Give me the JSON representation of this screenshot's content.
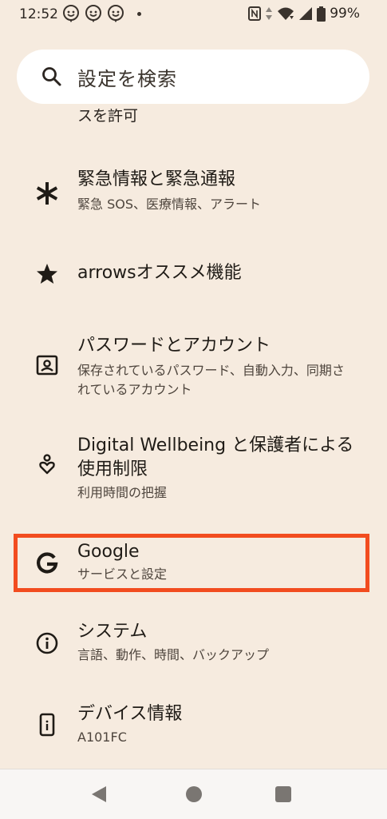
{
  "status_bar": {
    "time": "12:52",
    "battery": "99%",
    "notification_icons": [
      "face-notification-icon",
      "face-notification-icon",
      "face-notification-icon"
    ],
    "system_icons": [
      "nfc-icon",
      "data-arrows-icon",
      "wifi-icon",
      "signal-icon",
      "battery-icon"
    ]
  },
  "search": {
    "placeholder": "設定を検索"
  },
  "clipped_item": {
    "text": "スを許可"
  },
  "items": [
    {
      "title": "緊急情報と緊急通報",
      "subtitle": "緊急 SOS、医療情報、アラート",
      "icon": "asterisk-icon"
    },
    {
      "title": "arrowsオススメ機能",
      "subtitle": "",
      "icon": "star-icon"
    },
    {
      "title": "パスワードとアカウント",
      "subtitle": "保存されているパスワード、自動入力、同期されているアカウント",
      "icon": "account-box-icon"
    },
    {
      "title": "Digital Wellbeing と保護者による使用制限",
      "subtitle": "利用時間の把握",
      "icon": "wellbeing-icon"
    },
    {
      "title": "Google",
      "subtitle": "サービスと設定",
      "icon": "google-icon"
    },
    {
      "title": "システム",
      "subtitle": "言語、動作、時間、バックアップ",
      "icon": "info-icon"
    },
    {
      "title": "デバイス情報",
      "subtitle": "A101FC",
      "icon": "phone-info-icon"
    }
  ],
  "highlight_color": "#f24c1f",
  "background_color": "#f6ebdf",
  "nav_bar": {
    "buttons": [
      "back-icon",
      "home-icon",
      "recents-icon"
    ]
  }
}
